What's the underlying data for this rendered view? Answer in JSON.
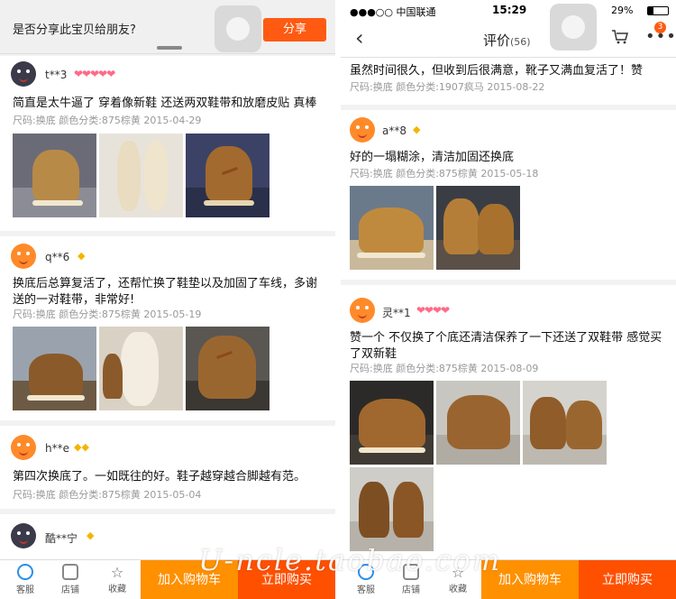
{
  "share": {
    "question": "是否分享此宝贝给朋友?",
    "button": "分享"
  },
  "status": {
    "carrier": "●●●○○ 中国联通",
    "time": "15:29",
    "battery": "29%"
  },
  "nav": {
    "back": "‹",
    "title": "评价",
    "count": "(56)",
    "more": "•••",
    "badge": "3"
  },
  "left_reviews": [
    {
      "user": "t**3",
      "medals": "❤❤❤❤❤",
      "text": "简直是太牛逼了 穿着像新鞋 还送两双鞋带和放磨皮贴 真棒",
      "meta": "尺码:换底   颜色分类:875棕黄   2015-04-29"
    },
    {
      "user": "q**6",
      "crowns": "◆",
      "text": "换底后总算复活了，还帮忙换了鞋垫以及加固了车线，多谢送的一对鞋带，非常好!",
      "meta": "尺码:换底   颜色分类:875棕黄   2015-05-19"
    },
    {
      "user": "h**e",
      "crowns": "◆◆",
      "text": "第四次换底了。一如既往的好。鞋子越穿越合脚越有范。",
      "meta": "尺码:换底   颜色分类:875棕黄   2015-05-04"
    },
    {
      "user": "酷**宁",
      "crowns": "◆"
    }
  ],
  "right_reviews": [
    {
      "text": "虽然时间很久，但收到后很满意，靴子又满血复活了！赞",
      "meta": "尺码:换底   颜色分类:1907疯马   2015-08-22"
    },
    {
      "user": "a**8",
      "crowns": "◆",
      "text": "好的一塌糊涂，清洁加固还换底",
      "meta": "尺码:换底   颜色分类:875棕黄   2015-05-18"
    },
    {
      "user": "灵**1",
      "medals": "❤❤❤❤",
      "text": "赞一个 不仅换了个底还清洁保养了一下还送了双鞋带 感觉买了双新鞋",
      "meta": "尺码:换底   颜色分类:875棕黄   2015-08-09"
    }
  ],
  "bottom": {
    "service": "客服",
    "shop": "店铺",
    "fav": "收藏",
    "cart": "加入购物车",
    "buy": "立即购买"
  },
  "watermark": "U-ncle.taobao.com",
  "colors": {
    "orange": "#ff9000",
    "red_orange": "#ff5000",
    "share_btn": "#ff5a12"
  }
}
